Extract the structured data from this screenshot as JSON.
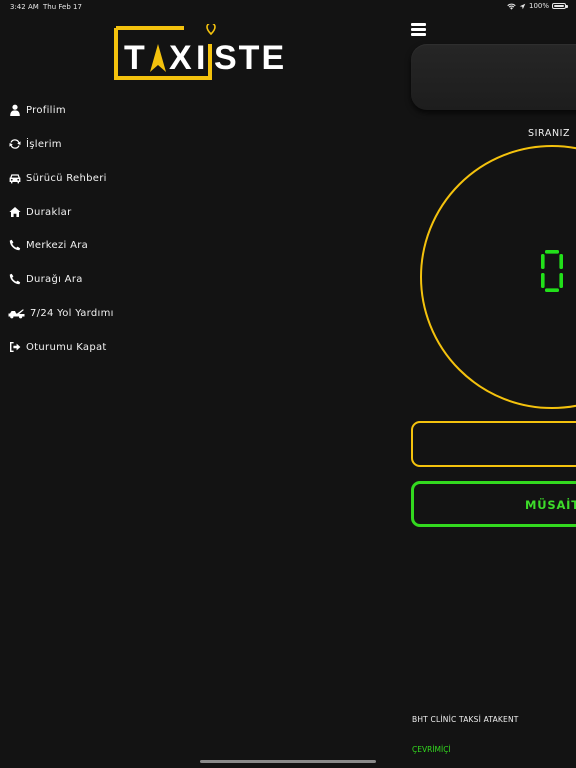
{
  "status_bar": {
    "time": "3:42 AM",
    "date": "Thu Feb 17",
    "battery": "100%"
  },
  "logo": {
    "text": "TAXISTE",
    "accent_color": "#f4c20d"
  },
  "menu": {
    "items": [
      {
        "label": "Profilim",
        "icon": "user-icon"
      },
      {
        "label": "İşlerim",
        "icon": "refresh-icon"
      },
      {
        "label": "Sürücü Rehberi",
        "icon": "car-icon"
      },
      {
        "label": "Duraklar",
        "icon": "home-icon"
      },
      {
        "label": "Merkezi Ara",
        "icon": "phone-icon"
      },
      {
        "label": "Durağı Ara",
        "icon": "phone-icon"
      },
      {
        "label": "7/24 Yol Yardımı",
        "icon": "tow-truck-icon"
      },
      {
        "label": "Oturumu Kapat",
        "icon": "sign-out-icon"
      }
    ]
  },
  "main": {
    "queue_label": "SIRANIZ",
    "queue_value": "0",
    "available_button": "MÜSAİT",
    "stand_name": "BHT CLİNİC TAKSİ ATAKENT",
    "status": "ÇEVRİMİÇİ"
  },
  "colors": {
    "background": "#131313",
    "accent_yellow": "#f4c20d",
    "accent_green": "#33d91f"
  }
}
